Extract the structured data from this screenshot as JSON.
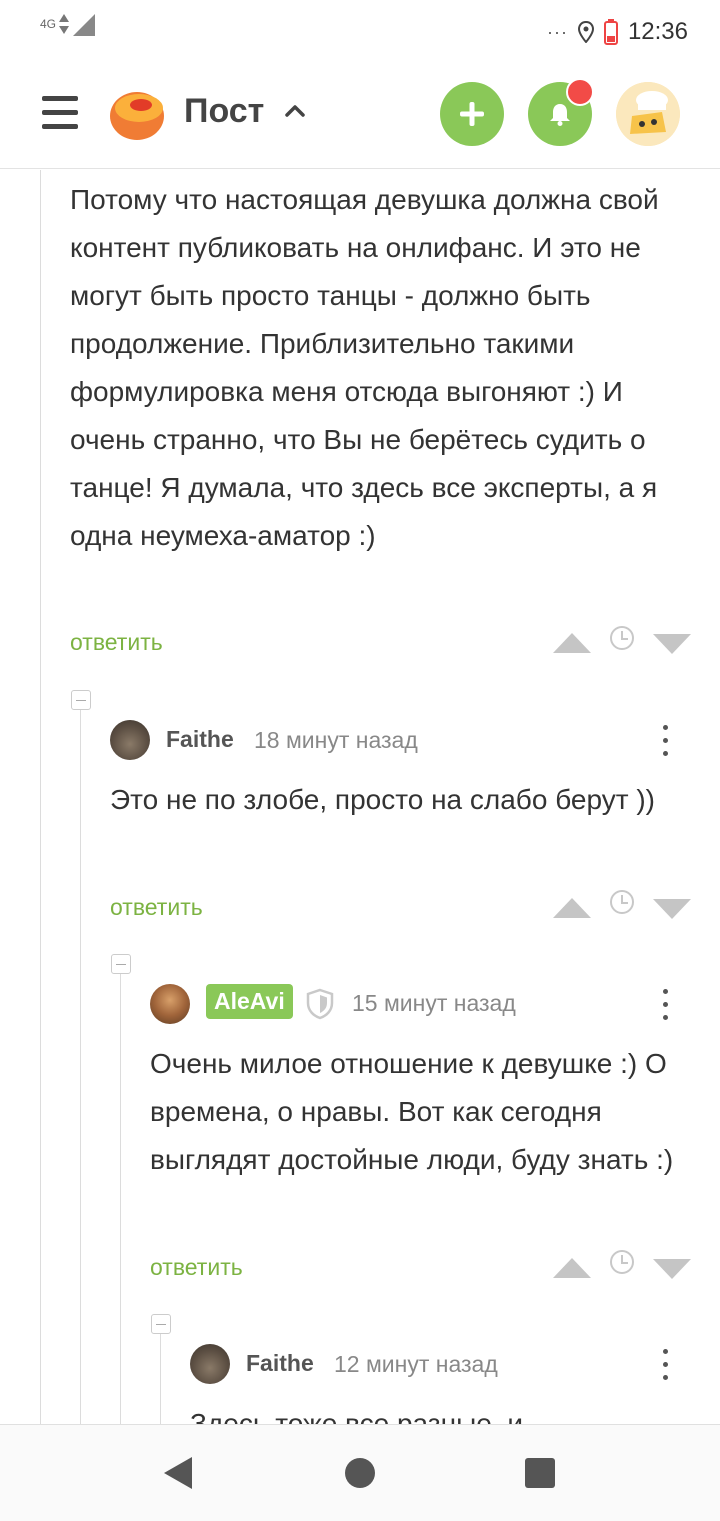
{
  "status_bar": {
    "network": "4G",
    "dots": "···",
    "time": "12:36"
  },
  "header": {
    "title": "Пост"
  },
  "comments": [
    {
      "text": "Потому что настоящая девушка должна свой контент публиковать на онлифанс. И это не могут быть просто танцы - должно быть продолжение. Приблизительно такими формулировка меня отсюда выгоняют :) И очень странно, что Вы не берётесь судить о танце! Я думала, что здесь все эксперты, а я одна неумеха-аматор :)",
      "reply_label": "ответить"
    },
    {
      "author": "Faithe",
      "time": "18 минут назад",
      "text": "Это не по злобе, просто на слабо берут ))",
      "reply_label": "ответить"
    },
    {
      "author": "AleAvi",
      "time": "15 минут назад",
      "text": "Очень милое отношение к девушке :) О времена, о нравы. Вот как сегодня выглядят достойные люди, буду знать :)",
      "reply_label": "ответить"
    },
    {
      "author": "Faithe",
      "time": "12 минут назад",
      "text": "Здесь тоже все разные, и"
    }
  ],
  "colors": {
    "accent_green": "#8ac858",
    "link_green": "#7cb342",
    "notification_red": "#f24b47"
  },
  "icons": [
    "menu-icon",
    "pikabu-logo-icon",
    "chevron-up-icon",
    "plus-icon",
    "bell-icon",
    "clock-icon",
    "vote-up-icon",
    "vote-down-icon",
    "shield-icon",
    "kebab-menu-icon",
    "nav-back-icon",
    "nav-home-icon",
    "nav-recent-icon"
  ]
}
